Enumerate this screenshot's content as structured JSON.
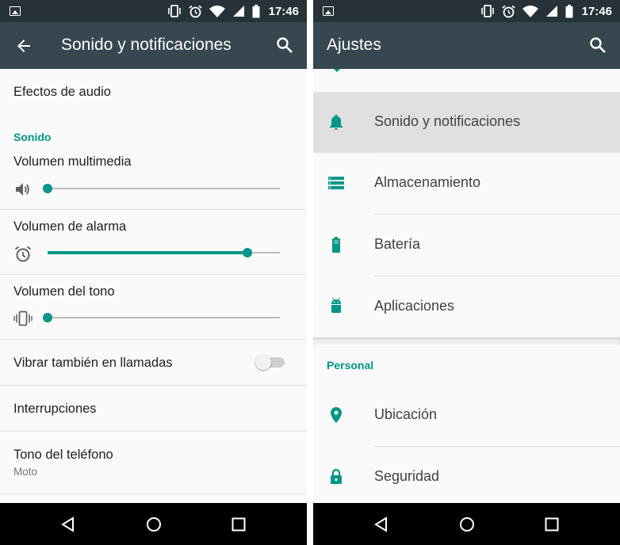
{
  "status_bar": {
    "time": "17:46",
    "icons": [
      "image-notification-icon",
      "vibrate-icon",
      "alarm-icon",
      "wifi-icon",
      "no-sim-icon",
      "battery-icon"
    ]
  },
  "left": {
    "app_bar": {
      "title": "Sonido y notificaciones",
      "back_icon": "arrow-back-icon",
      "search_icon": "search-icon"
    },
    "items": {
      "audio_effects": "Efectos de audio",
      "section_sound": "Sonido",
      "media_volume": {
        "label": "Volumen multimedia",
        "icon": "volume-icon",
        "level": 0
      },
      "alarm_volume": {
        "label": "Volumen de alarma",
        "icon": "alarm-icon",
        "level": 0.86
      },
      "ring_volume": {
        "label": "Volumen del tono",
        "icon": "vibrate-icon",
        "level": 0
      },
      "vibrate_calls": {
        "label": "Vibrar también en llamadas",
        "checked": false
      },
      "interruptions": "Interrupciones",
      "ringtone": {
        "label": "Tono del teléfono",
        "value": "Moto"
      }
    }
  },
  "right": {
    "app_bar": {
      "title": "Ajustes",
      "search_icon": "search-icon"
    },
    "device_items": [
      {
        "label": "Sonido y notificaciones",
        "icon": "bell-icon",
        "selected": true
      },
      {
        "label": "Almacenamiento",
        "icon": "storage-icon",
        "selected": false
      },
      {
        "label": "Batería",
        "icon": "battery-icon",
        "selected": false
      },
      {
        "label": "Aplicaciones",
        "icon": "android-icon",
        "selected": false
      }
    ],
    "section_personal": "Personal",
    "personal_items": [
      {
        "label": "Ubicación",
        "icon": "location-icon"
      },
      {
        "label": "Seguridad",
        "icon": "lock-icon"
      }
    ]
  },
  "nav_bar": {
    "buttons": [
      "back-triangle-icon",
      "home-circle-icon",
      "recents-square-icon"
    ]
  },
  "colors": {
    "accent": "#009688",
    "status_bar": "#263238",
    "app_bar": "#37474f",
    "nav_bar": "#000000",
    "selected_row": "#e0e0e0"
  }
}
